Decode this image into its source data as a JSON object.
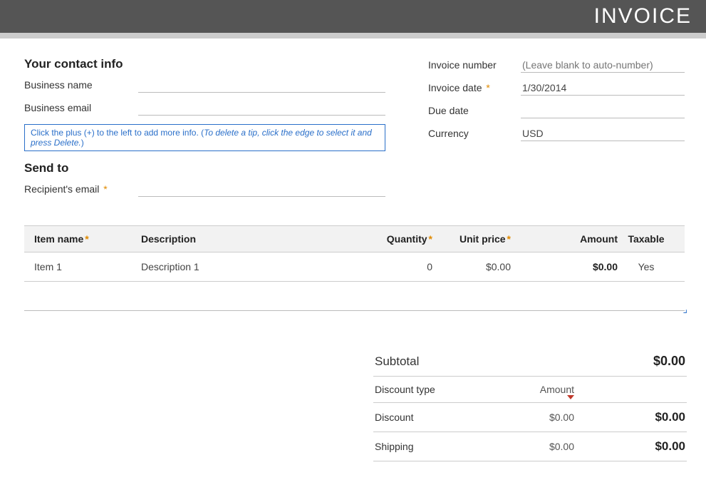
{
  "header": {
    "title": "INVOICE"
  },
  "contact": {
    "section_title": "Your contact info",
    "business_name_label": "Business name",
    "business_name_value": "",
    "business_email_label": "Business email",
    "business_email_value": ""
  },
  "tip": {
    "text_main": "Click the plus (+) to the left to add more info. (",
    "text_italic": "To delete a tip, click the edge to select it and press Delete.",
    "text_end": ")"
  },
  "sendto": {
    "section_title": "Send to",
    "recipient_email_label": "Recipient's email",
    "recipient_email_value": ""
  },
  "invoice_meta": {
    "number_label": "Invoice number",
    "number_placeholder": "(Leave blank to auto-number)",
    "date_label": "Invoice date",
    "date_value": "1/30/2014",
    "due_label": "Due date",
    "due_value": "",
    "currency_label": "Currency",
    "currency_value": "USD"
  },
  "table": {
    "headers": {
      "name": "Item name",
      "desc": "Description",
      "qty": "Quantity",
      "unit": "Unit price",
      "amount": "Amount",
      "taxable": "Taxable"
    },
    "rows": [
      {
        "name": "Item 1",
        "desc": "Description 1",
        "qty": "0",
        "unit": "$0.00",
        "amount": "$0.00",
        "taxable": "Yes"
      }
    ]
  },
  "summary": {
    "subtotal_label": "Subtotal",
    "subtotal_value": "$0.00",
    "discount_type_label": "Discount type",
    "discount_type_value": "Amount",
    "discount_label": "Discount",
    "discount_input": "$0.00",
    "discount_value": "$0.00",
    "shipping_label": "Shipping",
    "shipping_input": "$0.00",
    "shipping_value": "$0.00"
  },
  "required_marker": "*"
}
